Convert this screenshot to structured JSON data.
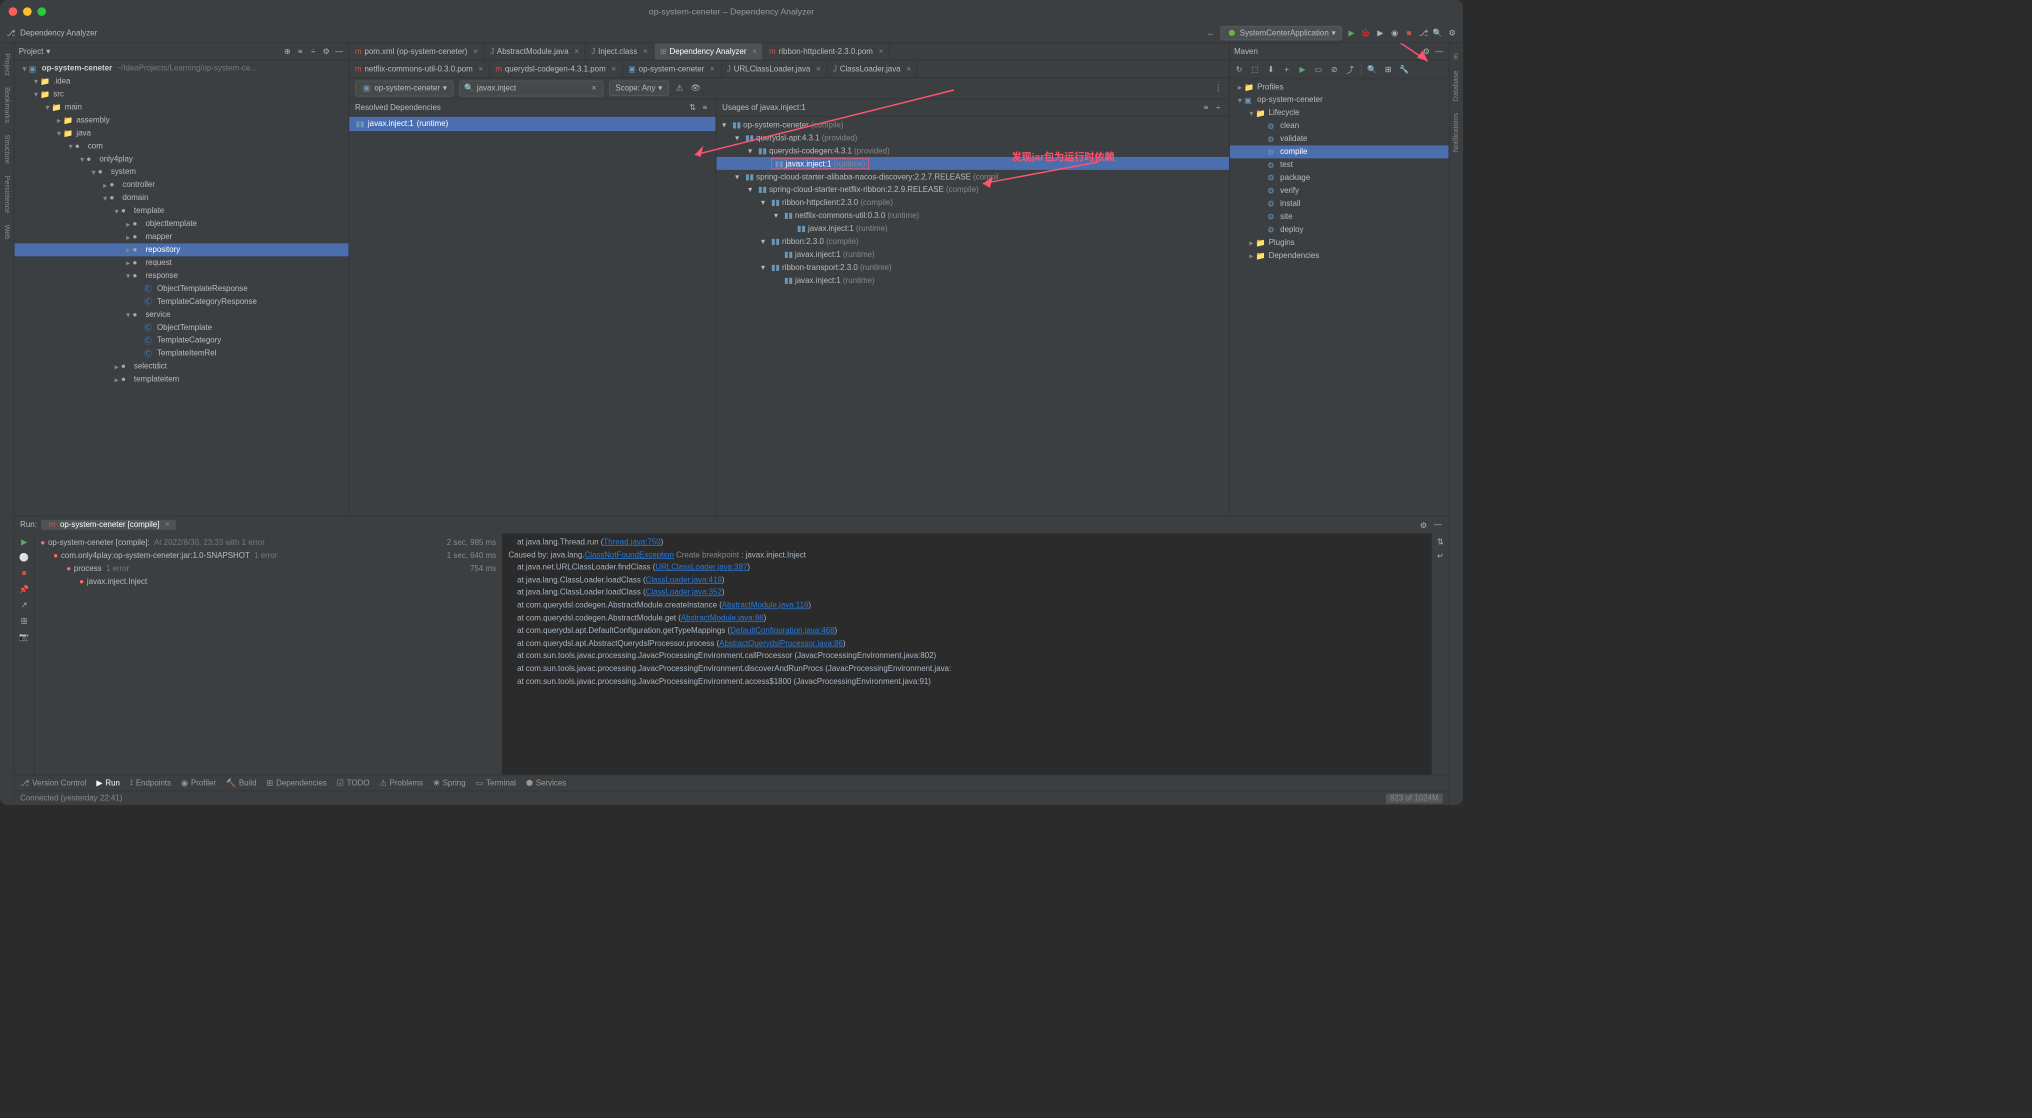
{
  "title": "op-system-ceneter – Dependency Analyzer",
  "toolbar": {
    "analyzer": "Dependency Analyzer",
    "runConfig": "SystemCenterApplication"
  },
  "projHdr": "Project",
  "projRoot": {
    "name": "op-system-ceneter",
    "path": "~/IdeaProjects/Learning/op-system-ce..."
  },
  "tree": [
    {
      "d": 1,
      "a": "v",
      "ic": "fold",
      "t": ".idea"
    },
    {
      "d": 1,
      "a": "v",
      "ic": "fold",
      "t": "src"
    },
    {
      "d": 2,
      "a": "v",
      "ic": "fold",
      "t": "main"
    },
    {
      "d": 3,
      "a": ">",
      "ic": "fold",
      "t": "assembly"
    },
    {
      "d": 3,
      "a": "v",
      "ic": "fold",
      "t": "java",
      "blue": true
    },
    {
      "d": 4,
      "a": "v",
      "ic": "pkg",
      "t": "com"
    },
    {
      "d": 5,
      "a": "v",
      "ic": "pkg",
      "t": "only4play"
    },
    {
      "d": 6,
      "a": "v",
      "ic": "pkg",
      "t": "system"
    },
    {
      "d": 7,
      "a": ">",
      "ic": "pkg",
      "t": "controller"
    },
    {
      "d": 7,
      "a": "v",
      "ic": "pkg",
      "t": "domain"
    },
    {
      "d": 8,
      "a": "v",
      "ic": "pkg",
      "t": "template"
    },
    {
      "d": 9,
      "a": ">",
      "ic": "pkg",
      "t": "objecttemplate"
    },
    {
      "d": 9,
      "a": ">",
      "ic": "pkg",
      "t": "mapper"
    },
    {
      "d": 9,
      "a": ">",
      "ic": "pkg",
      "t": "repository",
      "sel": true
    },
    {
      "d": 9,
      "a": ">",
      "ic": "pkg",
      "t": "request"
    },
    {
      "d": 9,
      "a": "v",
      "ic": "pkg",
      "t": "response"
    },
    {
      "d": 10,
      "a": "",
      "ic": "cls",
      "t": "ObjectTemplateResponse"
    },
    {
      "d": 10,
      "a": "",
      "ic": "cls",
      "t": "TemplateCategoryResponse"
    },
    {
      "d": 9,
      "a": "v",
      "ic": "pkg",
      "t": "service"
    },
    {
      "d": 10,
      "a": "",
      "ic": "cls",
      "t": "ObjectTemplate"
    },
    {
      "d": 10,
      "a": "",
      "ic": "cls",
      "t": "TemplateCategory"
    },
    {
      "d": 10,
      "a": "",
      "ic": "cls",
      "t": "TemplateItemRel"
    },
    {
      "d": 8,
      "a": ">",
      "ic": "pkg",
      "t": "selectdict"
    },
    {
      "d": 8,
      "a": ">",
      "ic": "pkg",
      "t": "templateitem"
    }
  ],
  "tabs1": [
    {
      "ic": "m",
      "t": "pom.xml (op-system-ceneter)"
    },
    {
      "ic": "j",
      "t": "AbstractModule.java"
    },
    {
      "ic": "j",
      "t": "Inject.class"
    },
    {
      "ic": "d",
      "t": "Dependency Analyzer",
      "active": true
    },
    {
      "ic": "m",
      "t": "ribbon-httpclient-2.3.0.pom"
    }
  ],
  "tabs2": [
    {
      "ic": "m",
      "t": "netflix-commons-util-0.3.0.pom"
    },
    {
      "ic": "m",
      "t": "querydsl-codegen-4.3.1.pom"
    },
    {
      "ic": "mo",
      "t": "op-system-ceneter"
    },
    {
      "ic": "j",
      "t": "URLClassLoader.java"
    },
    {
      "ic": "j",
      "t": "ClassLoader.java"
    }
  ],
  "depBar": {
    "module": "op-system-ceneter",
    "search": "javax.inject",
    "scope": "Scope: Any"
  },
  "resolvedHdr": "Resolved Dependencies",
  "resolved": {
    "name": "javax.inject:1",
    "scope": "(runtime)"
  },
  "usagesHdr": "Usages of javax.inject:1",
  "usages": [
    {
      "d": 0,
      "a": "v",
      "t": "op-system-ceneter",
      "s": "(compile)"
    },
    {
      "d": 1,
      "a": "v",
      "t": "querydsl-apt:4.3.1",
      "s": "(provided)"
    },
    {
      "d": 2,
      "a": "v",
      "t": "querydsl-codegen:4.3.1",
      "s": "(provided)"
    },
    {
      "d": 3,
      "a": "",
      "t": "javax.inject:1",
      "s": "(runtime)",
      "hl": true,
      "sel": true
    },
    {
      "d": 1,
      "a": "v",
      "t": "spring-cloud-starter-alibaba-nacos-discovery:2.2.7.RELEASE",
      "s": "(compil"
    },
    {
      "d": 2,
      "a": "v",
      "t": "spring-cloud-starter-netflix-ribbon:2.2.9.RELEASE",
      "s": "(compile)"
    },
    {
      "d": 3,
      "a": "v",
      "t": "ribbon-httpclient:2.3.0",
      "s": "(compile)"
    },
    {
      "d": 4,
      "a": "v",
      "t": "netflix-commons-util:0.3.0",
      "s": "(runtime)"
    },
    {
      "d": 5,
      "a": "",
      "t": "javax.inject:1",
      "s": "(runtime)"
    },
    {
      "d": 3,
      "a": "v",
      "t": "ribbon:2.3.0",
      "s": "(compile)"
    },
    {
      "d": 4,
      "a": "",
      "t": "javax.inject:1",
      "s": "(runtime)"
    },
    {
      "d": 3,
      "a": "v",
      "t": "ribbon-transport:2.3.0",
      "s": "(runtime)"
    },
    {
      "d": 4,
      "a": "",
      "t": "javax.inject:1",
      "s": "(runtime)"
    }
  ],
  "annotation": "发现jar包为运行时依赖",
  "mvnHdr": "Maven",
  "mvn": [
    {
      "d": 0,
      "a": ">",
      "ic": "f",
      "t": "Profiles"
    },
    {
      "d": 0,
      "a": "v",
      "ic": "m",
      "t": "op-system-ceneter"
    },
    {
      "d": 1,
      "a": "v",
      "ic": "f",
      "t": "Lifecycle"
    },
    {
      "d": 2,
      "ic": "g",
      "t": "clean"
    },
    {
      "d": 2,
      "ic": "g",
      "t": "validate"
    },
    {
      "d": 2,
      "ic": "g",
      "t": "compile",
      "sel": true
    },
    {
      "d": 2,
      "ic": "g",
      "t": "test"
    },
    {
      "d": 2,
      "ic": "g",
      "t": "package"
    },
    {
      "d": 2,
      "ic": "g",
      "t": "verify"
    },
    {
      "d": 2,
      "ic": "g",
      "t": "install"
    },
    {
      "d": 2,
      "ic": "g",
      "t": "site"
    },
    {
      "d": 2,
      "ic": "g",
      "t": "deploy"
    },
    {
      "d": 1,
      "a": ">",
      "ic": "f",
      "t": "Plugins"
    },
    {
      "d": 1,
      "a": ">",
      "ic": "f",
      "t": "Dependencies"
    }
  ],
  "runHdr": {
    "label": "Run:",
    "tab": "op-system-ceneter [compile]"
  },
  "runTree": [
    {
      "d": 0,
      "ic": "err",
      "t": "op-system-ceneter [compile]:",
      "after": "At 2022/8/30, 23:33 with 1 error",
      "time": "2 sec, 985 ms"
    },
    {
      "d": 1,
      "ic": "err",
      "t": "com.only4play:op-system-ceneter:jar:1.0-SNAPSHOT",
      "after": "1 error",
      "time": "1 sec, 640 ms"
    },
    {
      "d": 2,
      "ic": "err",
      "t": "process",
      "after": "1 error",
      "time": "754 ms"
    },
    {
      "d": 3,
      "ic": "err",
      "t": "javax.inject.Inject"
    }
  ],
  "console": [
    {
      "pre": "    at java.lang.Thread.run (",
      "lnk": "Thread.java:750",
      "post": ")"
    },
    {
      "pre": "Caused by: java.lang.",
      "lnk": "ClassNotFoundException",
      "post": " Create breakpoint : javax.inject.Inject",
      "cb": true
    },
    {
      "pre": "    at java.net.URLClassLoader.findClass (",
      "lnk": "URLClassLoader.java:387",
      "post": ")"
    },
    {
      "pre": "    at java.lang.ClassLoader.loadClass (",
      "lnk": "ClassLoader.java:419",
      "post": ")"
    },
    {
      "pre": "    at java.lang.ClassLoader.loadClass (",
      "lnk": "ClassLoader.java:352",
      "post": ")"
    },
    {
      "pre": "    at com.querydsl.codegen.AbstractModule.createInstance (",
      "lnk": "AbstractModule.java:116",
      "post": ")"
    },
    {
      "pre": "    at com.querydsl.codegen.AbstractModule.get (",
      "lnk": "AbstractModule.java:86",
      "post": ")"
    },
    {
      "pre": "    at com.querydsl.apt.DefaultConfiguration.getTypeMappings (",
      "lnk": "DefaultConfiguration.java:468",
      "post": ")"
    },
    {
      "pre": "    at com.querydsl.apt.AbstractQuerydslProcessor.process (",
      "lnk": "AbstractQuerydslProcessor.java:86",
      "post": ")"
    },
    {
      "pre": "    at com.sun.tools.javac.processing.JavacProcessingEnvironment.callProcessor (JavacProcessingEnvironment.java:802)"
    },
    {
      "pre": "    at com.sun.tools.javac.processing.JavacProcessingEnvironment.discoverAndRunProcs (JavacProcessingEnvironment.java:"
    },
    {
      "pre": "    at com.sun.tools.javac.processing.JavacProcessingEnvironment.access$1800 (JavacProcessingEnvironment.java:91)"
    }
  ],
  "bottomBar": [
    "Version Control",
    "Run",
    "Endpoints",
    "Profiler",
    "Build",
    "Dependencies",
    "TODO",
    "Problems",
    "Spring",
    "Terminal",
    "Services"
  ],
  "status": {
    "left": "Connected (yesterday 22:41)",
    "right": "823 of 1024M"
  },
  "sideL": [
    "Project",
    "Bookmarks",
    "Structure",
    "Persistence",
    "Web"
  ],
  "sideR": [
    "m",
    "Database",
    "Notifications"
  ]
}
